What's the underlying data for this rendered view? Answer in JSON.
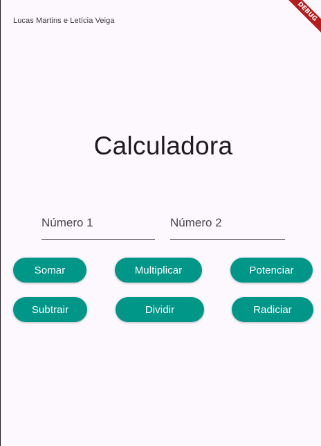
{
  "app_bar": {
    "title": "Lucas Martins e Letícia Veiga",
    "debug_badge": "DEBUG"
  },
  "heading": "Calculadora",
  "inputs": {
    "numero1_placeholder": "Número 1",
    "numero2_placeholder": "Número 2"
  },
  "buttons": {
    "somar": "Somar",
    "multiplicar": "Multiplicar",
    "potenciar": "Potenciar",
    "subtrair": "Subtrair",
    "dividir": "Dividir",
    "radiciar": "Radiciar"
  },
  "colors": {
    "background": "#fdf7fe",
    "button": "#009688",
    "debug_ribbon": "#b71c1c"
  }
}
